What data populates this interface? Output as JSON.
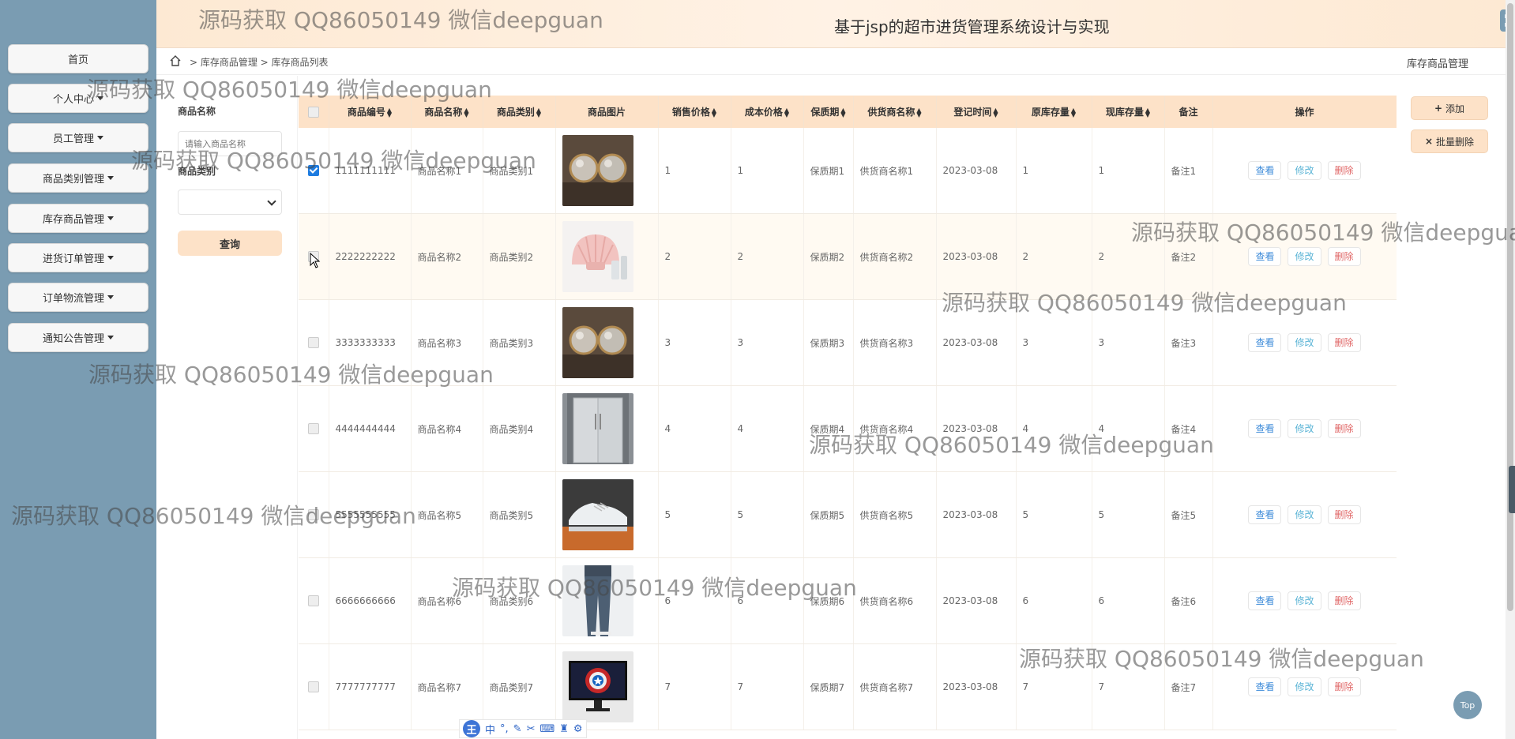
{
  "header": {
    "title": "基于jsp的超市进货管理系统设计与实现"
  },
  "sidebar": {
    "items": [
      {
        "label": "首页",
        "dropdown": false
      },
      {
        "label": "个人中心",
        "dropdown": true
      },
      {
        "label": "员工管理",
        "dropdown": true
      },
      {
        "label": "商品类别管理",
        "dropdown": true
      },
      {
        "label": "库存商品管理",
        "dropdown": true
      },
      {
        "label": "进货订单管理",
        "dropdown": true
      },
      {
        "label": "订单物流管理",
        "dropdown": true
      },
      {
        "label": "通知公告管理",
        "dropdown": true
      }
    ]
  },
  "breadcrumb": {
    "path": "> 库存商品管理 > 库存商品列表",
    "right": "库存商品管理"
  },
  "filter": {
    "name_label": "商品名称",
    "name_placeholder": "请输入商品名称",
    "type_label": "商品类别",
    "search_label": "查询"
  },
  "actions": {
    "add": "添加",
    "batch_delete": "批量删除"
  },
  "table": {
    "columns": [
      "商品编号",
      "商品名称",
      "商品类别",
      "商品图片",
      "销售价格",
      "成本价格",
      "保质期",
      "供货商名称",
      "登记时间",
      "原库存量",
      "现库存量",
      "备注",
      "操作"
    ],
    "sortable": [
      true,
      true,
      true,
      false,
      true,
      true,
      true,
      true,
      true,
      true,
      true,
      false,
      false
    ],
    "rows": [
      {
        "id": "1111111111",
        "name": "商品名称1",
        "type": "商品类别1",
        "img": "glasses",
        "sale": "1",
        "cost": "1",
        "shelf": "保质期1",
        "supplier": "供货商名称1",
        "date": "2023-03-08",
        "orig": "1",
        "cur": "1",
        "note": "备注1",
        "checked": true
      },
      {
        "id": "2222222222",
        "name": "商品名称2",
        "type": "商品类别2",
        "img": "shell",
        "sale": "2",
        "cost": "2",
        "shelf": "保质期2",
        "supplier": "供货商名称2",
        "date": "2023-03-08",
        "orig": "2",
        "cur": "2",
        "note": "备注2",
        "checked": false
      },
      {
        "id": "3333333333",
        "name": "商品名称3",
        "type": "商品类别3",
        "img": "glasses",
        "sale": "3",
        "cost": "3",
        "shelf": "保质期3",
        "supplier": "供货商名称3",
        "date": "2023-03-08",
        "orig": "3",
        "cur": "3",
        "note": "备注3",
        "checked": false
      },
      {
        "id": "4444444444",
        "name": "商品名称4",
        "type": "商品类别4",
        "img": "fridge",
        "sale": "4",
        "cost": "4",
        "shelf": "保质期4",
        "supplier": "供货商名称4",
        "date": "2023-03-08",
        "orig": "4",
        "cur": "4",
        "note": "备注4",
        "checked": false
      },
      {
        "id": "5555555555",
        "name": "商品名称5",
        "type": "商品类别5",
        "img": "shoe",
        "sale": "5",
        "cost": "5",
        "shelf": "保质期5",
        "supplier": "供货商名称5",
        "date": "2023-03-08",
        "orig": "5",
        "cur": "5",
        "note": "备注5",
        "checked": false
      },
      {
        "id": "6666666666",
        "name": "商品名称6",
        "type": "商品类别6",
        "img": "pants",
        "sale": "6",
        "cost": "6",
        "shelf": "保质期6",
        "supplier": "供货商名称6",
        "date": "2023-03-08",
        "orig": "6",
        "cur": "6",
        "note": "备注6",
        "checked": false
      },
      {
        "id": "7777777777",
        "name": "商品名称7",
        "type": "商品类别7",
        "img": "monitor",
        "sale": "7",
        "cost": "7",
        "shelf": "保质期7",
        "supplier": "供货商名称7",
        "date": "2023-03-08",
        "orig": "7",
        "cur": "7",
        "note": "备注7",
        "checked": false
      }
    ],
    "row_actions": {
      "view": "查看",
      "edit": "修改",
      "delete": "删除"
    }
  },
  "top_button": "Top",
  "ime_logo": "王",
  "ime_chinese": "中",
  "watermark": "源码获取 QQ86050149 微信deepguan",
  "colors": {
    "sidebar": "#7a9cb2",
    "header_bg": "#fde9d3",
    "accent": "#fde2c8",
    "view": "#3d8bd9",
    "edit": "#5bb4d6",
    "delete": "#e06666"
  }
}
